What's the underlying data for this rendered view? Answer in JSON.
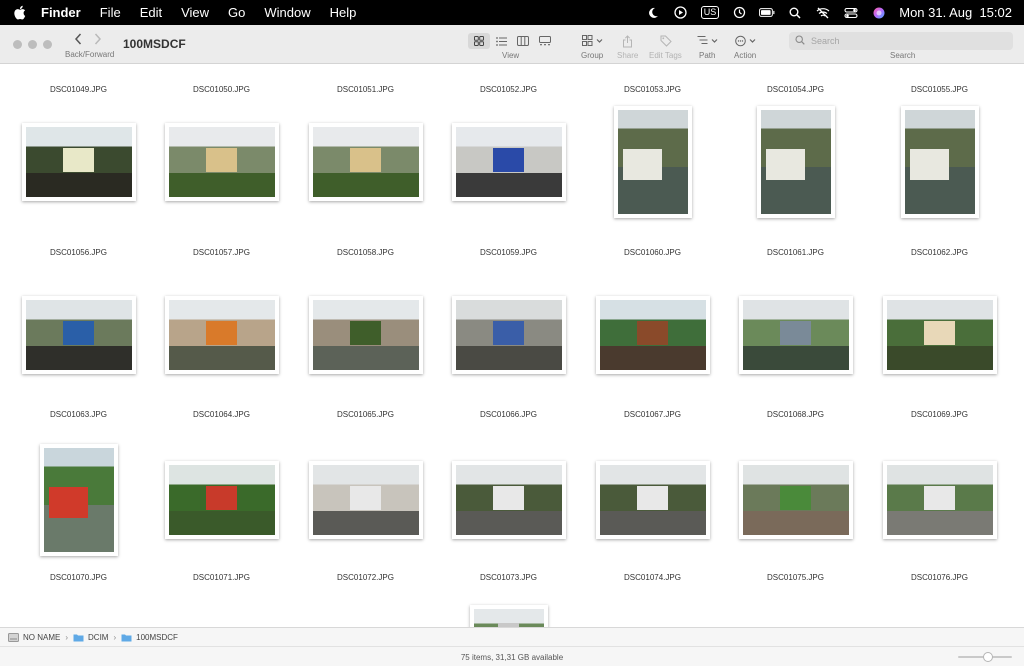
{
  "menubar": {
    "app": "Finder",
    "items": [
      "File",
      "Edit",
      "View",
      "Go",
      "Window",
      "Help"
    ],
    "input_source": "US",
    "clock": "Mon 31. Aug  15:02"
  },
  "toolbar": {
    "nav_caption": "Back/Forward",
    "title": "100MSDCF",
    "view_caption": "View",
    "group_label": "Group",
    "share_label": "Share",
    "edit_tags_label": "Edit Tags",
    "path_label": "Path",
    "action_label": "Action",
    "search_placeholder": "Search",
    "search_caption": "Search"
  },
  "files": {
    "header_row": [
      "DSC01049.JPG",
      "DSC01050.JPG",
      "DSC01051.JPG",
      "DSC01052.JPG",
      "DSC01053.JPG",
      "DSC01054.JPG",
      "DSC01055.JPG"
    ],
    "rows": [
      [
        "DSC01056.JPG",
        "DSC01057.JPG",
        "DSC01058.JPG",
        "DSC01059.JPG",
        "DSC01060.JPG",
        "DSC01061.JPG",
        "DSC01062.JPG"
      ],
      [
        "DSC01063.JPG",
        "DSC01064.JPG",
        "DSC01065.JPG",
        "DSC01066.JPG",
        "DSC01067.JPG",
        "DSC01068.JPG",
        "DSC01069.JPG"
      ],
      [
        "DSC01070.JPG",
        "DSC01071.JPG",
        "DSC01072.JPG",
        "DSC01073.JPG",
        "DSC01074.JPG",
        "DSC01075.JPG",
        "DSC01076.JPG"
      ]
    ]
  },
  "pathbar": {
    "segments": [
      "NO NAME",
      "DCIM",
      "100MSDCF"
    ]
  },
  "status": {
    "text": "75 items, 31,31 GB available"
  },
  "colors": {
    "accent": "#1a82fb",
    "folder": "#5fa9e6"
  }
}
